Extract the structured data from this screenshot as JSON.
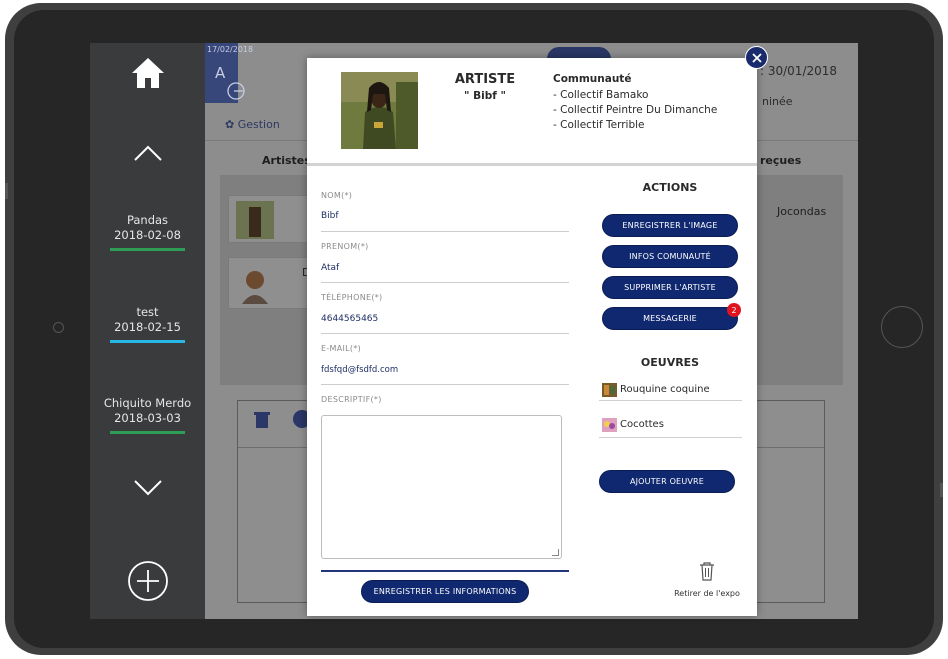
{
  "sidebar": {
    "items": [
      {
        "name": "Pandas",
        "date": "2018-02-08",
        "color": "#2e9e57"
      },
      {
        "name": "test",
        "date": "2018-02-15",
        "color": "#28b6e6"
      },
      {
        "name": "Chiquito Merdo",
        "date": "2018-03-03",
        "color": "#2e9e57"
      }
    ]
  },
  "background": {
    "small_date": "17/02/2018",
    "letter": "A",
    "gestion_tab": "Gestion",
    "date_right": ": 30/01/2018",
    "minee": "ninée",
    "col_artistes": "Artistes",
    "col_recues": "reçues",
    "jocondas": "Jocondas",
    "card_letter": "D"
  },
  "modal": {
    "title": "ARTISTE",
    "artist_name": "\" Bibf \"",
    "community_title": "Communauté",
    "communities": [
      "- Collectif Bamako",
      "- Collectif Peintre Du Dimanche",
      "- Collectif Terrible"
    ],
    "fields": {
      "nom_label": "NOM(*)",
      "nom_value": "Bibf",
      "prenom_label": "PRENOM(*)",
      "prenom_value": "Ataf",
      "tel_label": "TÉLÉPHONE(*)",
      "tel_value": "4644565465",
      "email_label": "E-MAIL(*)",
      "email_value": "fdsfqd@fsdfd.com",
      "desc_label": "DESCRIPTIF(*)",
      "desc_value": ""
    },
    "save_info_button": "ENREGISTRER LES INFORMATIONS",
    "actions_title": "ACTIONS",
    "actions": {
      "save_image": "ENREGISTRER L'IMAGE",
      "infos_communaute": "INFOS COMUNAUTÉ",
      "delete_artist": "SUPPRIMER L'ARTISTE",
      "messagerie": "MESSAGERIE"
    },
    "messagerie_badge": "2",
    "oeuvres_title": "OEUVRES",
    "oeuvres": [
      "Rouquine coquine",
      "Cocottes"
    ],
    "add_oeuvre_button": "AJOUTER OEUVRE",
    "remove_label": "Retirer de l'expo"
  },
  "colors": {
    "accent": "#10286f",
    "badge": "#e0141e"
  }
}
